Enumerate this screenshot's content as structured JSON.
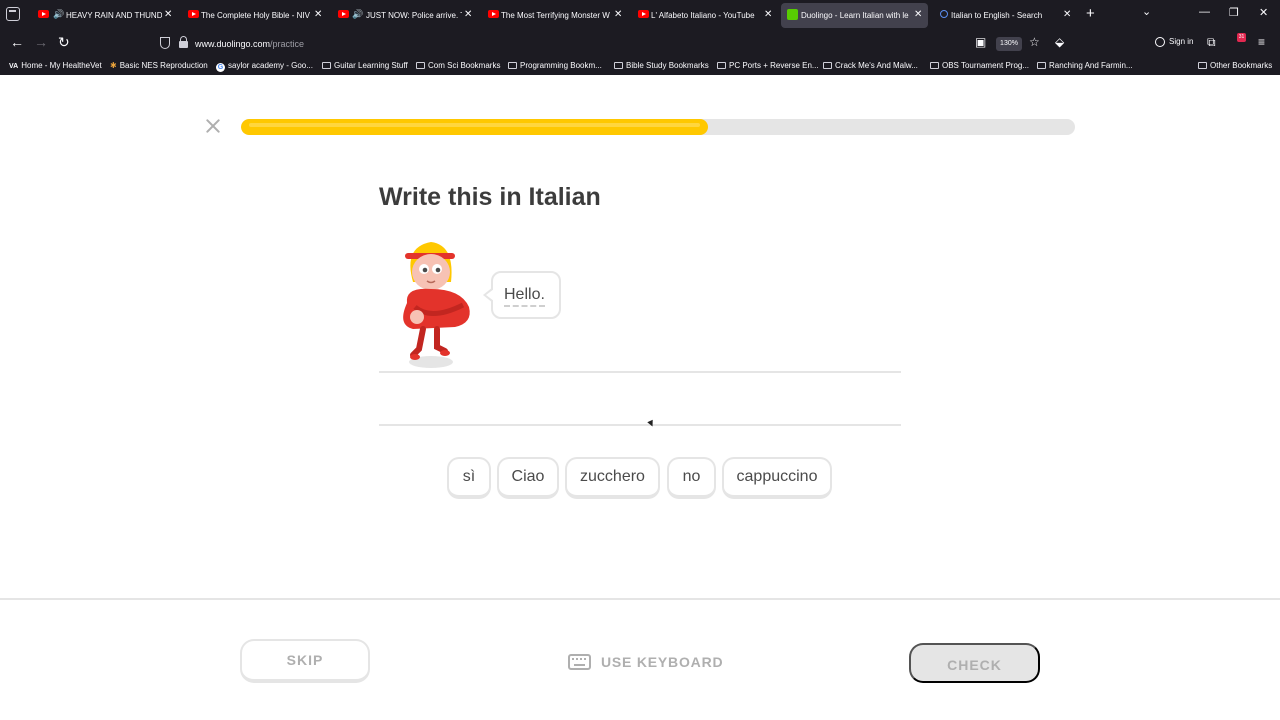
{
  "browser": {
    "tabs": [
      {
        "title": "HEAVY RAIN AND THUNDE",
        "kind": "youtube",
        "audio": true,
        "active": false
      },
      {
        "title": "The Complete Holy Bible - NIV",
        "kind": "youtube",
        "audio": false,
        "active": false
      },
      {
        "title": "JUST NOW: Police arrive. Tr",
        "kind": "youtube",
        "audio": true,
        "active": false
      },
      {
        "title": "The Most Terrifying Monster W",
        "kind": "youtube",
        "audio": false,
        "active": false
      },
      {
        "title": "L' Alfabeto Italiano - YouTube",
        "kind": "youtube",
        "audio": false,
        "active": false
      },
      {
        "title": "Duolingo - Learn Italian with le",
        "kind": "duolingo",
        "audio": false,
        "active": true
      },
      {
        "title": "Italian to English - Search",
        "kind": "search",
        "audio": false,
        "active": false
      }
    ],
    "url_domain": "www.duolingo.com",
    "url_path": "/practice",
    "zoom": "130%",
    "signin_label": "Sign in",
    "extension_badge": "31",
    "bookmarks": [
      {
        "label": "Home - My HealtheVet",
        "icon": "va"
      },
      {
        "label": "Basic NES Reproduction",
        "icon": "nes"
      },
      {
        "label": "saylor academy - Goo...",
        "icon": "google"
      },
      {
        "label": "Guitar Learning Stuff",
        "icon": "folder"
      },
      {
        "label": "Com Sci Bookmarks",
        "icon": "folder"
      },
      {
        "label": "Programming Bookm...",
        "icon": "folder"
      },
      {
        "label": "Bible Study Bookmarks",
        "icon": "folder"
      },
      {
        "label": "PC Ports + Reverse En...",
        "icon": "folder"
      },
      {
        "label": "Crack Me's And Malw...",
        "icon": "folder"
      },
      {
        "label": "OBS Tournament Prog...",
        "icon": "folder"
      },
      {
        "label": "Ranching And Farmin...",
        "icon": "folder"
      },
      {
        "label": "Other Bookmarks",
        "icon": "folder"
      }
    ]
  },
  "lesson": {
    "progress": 0.56,
    "title": "Write this in Italian",
    "prompt": "Hello.",
    "word_bank": [
      "sì",
      "Ciao",
      "zucchero",
      "no",
      "cappuccino"
    ],
    "skip_label": "SKIP",
    "keyboard_label": "USE KEYBOARD",
    "check_label": "CHECK"
  },
  "colors": {
    "progress_fill": "#ffc800",
    "progress_track": "#e5e5e5",
    "title_text": "#3c3c3c",
    "disabled": "#afafaf"
  }
}
